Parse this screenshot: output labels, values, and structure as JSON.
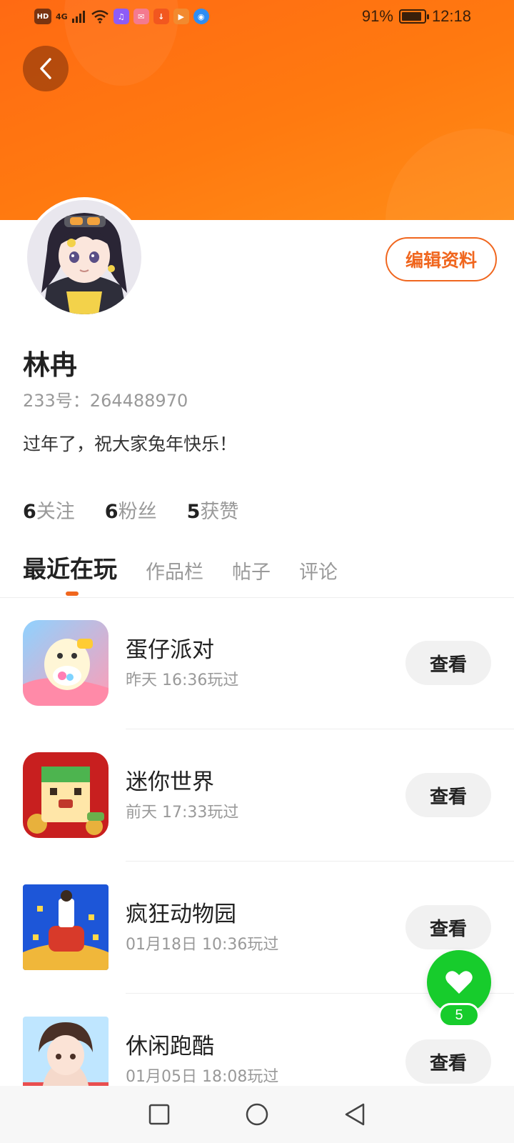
{
  "status_bar": {
    "network_hd": "HD",
    "network_gen": "4G",
    "battery_percent": "91%",
    "time": "12:18",
    "notification_icons": [
      "music-app-icon",
      "mail-app-icon",
      "download-icon",
      "video-app-icon",
      "browser-icon"
    ]
  },
  "colors": {
    "header": "#ff7510",
    "accent": "#f0661e",
    "like": "#17cc2c"
  },
  "profile": {
    "name": "林冉",
    "id_text": "233号：264488970",
    "bio": "过年了，祝大家兔年快乐！",
    "edit_button": "编辑资料",
    "stats": [
      {
        "num": "6",
        "label": "关注"
      },
      {
        "num": "6",
        "label": "粉丝"
      },
      {
        "num": "5",
        "label": "获赞"
      }
    ]
  },
  "tabs": [
    "最近在玩",
    "作品栏",
    "帖子",
    "评论"
  ],
  "active_tab": "最近在玩",
  "games": [
    {
      "name": "蛋仔派对",
      "time": "昨天 16:36玩过",
      "button": "查看"
    },
    {
      "name": "迷你世界",
      "time": "前天 17:33玩过",
      "button": "查看"
    },
    {
      "name": "疯狂动物园",
      "time": "01月18日 10:36玩过",
      "button": "查看"
    },
    {
      "name": "休闲跑酷",
      "time": "01月05日 18:08玩过",
      "button": "查看"
    }
  ],
  "like_fab": {
    "count": "5"
  }
}
